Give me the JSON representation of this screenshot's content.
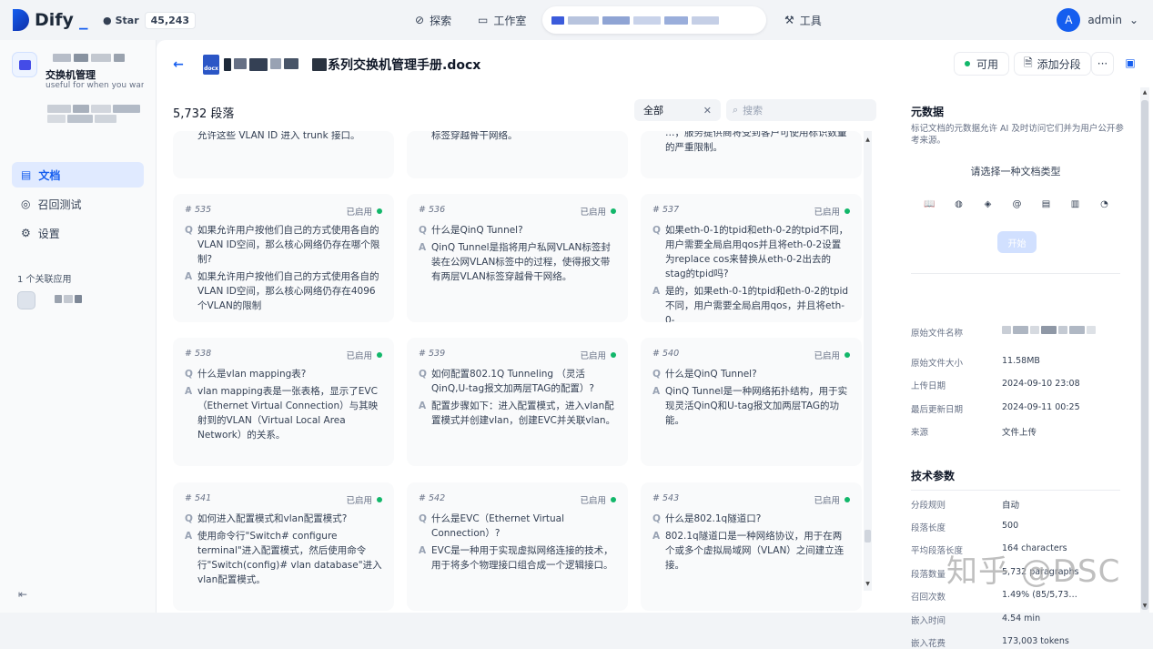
{
  "app": {
    "logo_text": "Dify",
    "logo_underscore": "_",
    "github_star": "Star",
    "github_count": "45,243"
  },
  "nav": {
    "explore": "探索",
    "studio": "工作室",
    "tools": "工具"
  },
  "user": {
    "initial": "A",
    "name": "admin"
  },
  "sidebar": {
    "dataset_name": "交换机管理",
    "dataset_desc": "useful for when you want to answer queries ab",
    "items": [
      {
        "label": "文档"
      },
      {
        "label": "召回测试"
      },
      {
        "label": "设置"
      }
    ],
    "associated": "1 个关联应用"
  },
  "header": {
    "doc_title": "系列交换机管理手册.docx",
    "status": "可用",
    "add_segment": "添加分段",
    "more": "···"
  },
  "segments": {
    "count": "5,732 段落",
    "filter": "全部",
    "search_placeholder": "搜索",
    "top_row": [
      "允许这些 VLAN ID 进入 trunk 接口。",
      "标签穿越骨干网络。",
      "…，服务提供商将受到客户可使用标识数量的严重限制。"
    ],
    "cards": [
      {
        "no": "# 535",
        "status": "已启用",
        "q": "如果允许用户按他们自己的方式使用各自的VLAN ID空间，那么核心网络仍存在哪个限制?",
        "a": "如果允许用户按他们自己的方式使用各自的VLAN ID空间，那么核心网络仍存在4096个VLAN的限制"
      },
      {
        "no": "# 536",
        "status": "已启用",
        "q": "什么是QinQ Tunnel?",
        "a": "QinQ Tunnel是指将用户私网VLAN标签封装在公网VLAN标签中的过程，使得报文带有两层VLAN标签穿越骨干网络。"
      },
      {
        "no": "# 537",
        "status": "已启用",
        "q": "如果eth-0-1的tpid和eth-0-2的tpid不同，用户需要全局启用qos并且将eth-0-2设置为replace cos来替换从eth-0-2出去的stag的tpid吗?",
        "a": "是的，如果eth-0-1的tpid和eth-0-2的tpid不同，用户需要全局启用qos，并且将eth-0-"
      },
      {
        "no": "# 538",
        "status": "已启用",
        "q": "什么是vlan mapping表?",
        "a": "vlan mapping表是一张表格，显示了EVC（Ethernet Virtual Connection）与其映射到的VLAN（Virtual Local Area Network）的关系。"
      },
      {
        "no": "# 539",
        "status": "已启用",
        "q": "如何配置802.1Q Tunneling （灵活QinQ,U-tag报文加两层TAG的配置）?",
        "a": "配置步骤如下：进入配置模式，进入vlan配置模式并创建vlan，创建EVC并关联vlan。"
      },
      {
        "no": "# 540",
        "status": "已启用",
        "q": "什么是QinQ Tunnel?",
        "a": "QinQ Tunnel是一种网络拓扑结构，用于实现灵活QinQ和U-tag报文加两层TAG的功能。"
      },
      {
        "no": "# 541",
        "status": "已启用",
        "q": "如何进入配置模式和vlan配置模式?",
        "a": "使用命令行\"Switch# configure terminal\"进入配置模式，然后使用命令行\"Switch(config)# vlan database\"进入vlan配置模式。"
      },
      {
        "no": "# 542",
        "status": "已启用",
        "q": "什么是EVC（Ethernet Virtual Connection）?",
        "a": "EVC是一种用于实现虚拟网络连接的技术，用于将多个物理接口组合成一个逻辑接口。"
      },
      {
        "no": "# 543",
        "status": "已启用",
        "q": "什么是802.1q隧道口?",
        "a": "802.1q隧道口是一种网络协议，用于在两个或多个虚拟局域网（VLAN）之间建立连接。"
      }
    ],
    "q_label": "Q",
    "a_label": "A"
  },
  "metadata": {
    "title": "元数据",
    "desc": "标记文档的元数据允许 AI 及时访问它们并为用户公开参考来源。",
    "choose": "请选择一种文档类型",
    "start": "开始",
    "file_rows": [
      {
        "k": "原始文件名称",
        "v": ""
      },
      {
        "k": "原始文件大小",
        "v": "11.58MB"
      },
      {
        "k": "上传日期",
        "v": "2024-09-10 23:08"
      },
      {
        "k": "最后更新日期",
        "v": "2024-09-11 00:25"
      },
      {
        "k": "来源",
        "v": "文件上传"
      }
    ],
    "tech_title": "技术参数",
    "tech_rows": [
      {
        "k": "分段规则",
        "v": "自动"
      },
      {
        "k": "段落长度",
        "v": "500"
      },
      {
        "k": "平均段落长度",
        "v": "164 characters"
      },
      {
        "k": "段落数量",
        "v": "5,732 paragraphs"
      },
      {
        "k": "召回次数",
        "v": "1.49% (85/5,73…"
      },
      {
        "k": "嵌入时间",
        "v": "4.54 min"
      },
      {
        "k": "嵌入花费",
        "v": "173,003 tokens"
      }
    ]
  },
  "watermark": "知乎 @DSC",
  "colors": {
    "accent": "#155eef",
    "enabled": "#12b76a"
  }
}
